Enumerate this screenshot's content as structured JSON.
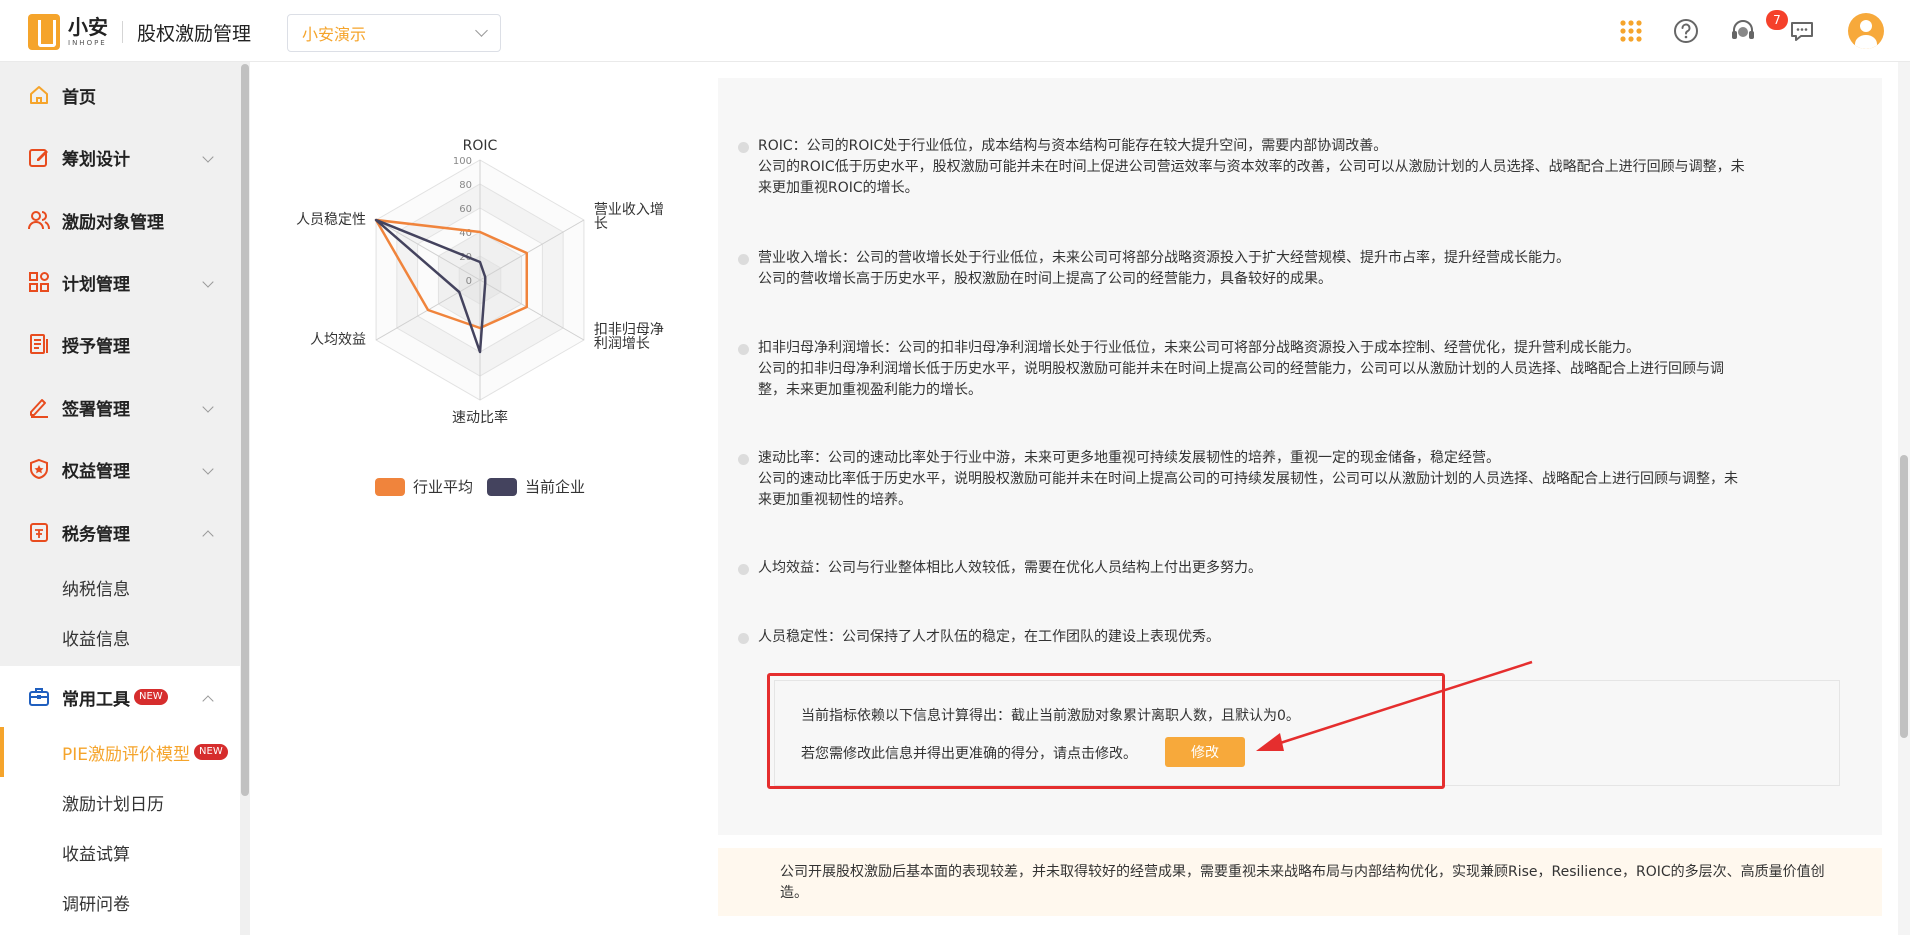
{
  "header": {
    "logo_cn": "小安",
    "logo_en": "INHOPE",
    "app_title": "股权激励管理",
    "company_selected": "小安演示",
    "icons": [
      "apps-grid-icon",
      "help-icon",
      "customer-service-icon",
      "message-icon",
      "user-avatar-icon"
    ],
    "message_badge": "7",
    "accent_color": "#f5a42b"
  },
  "sidebar": {
    "items": [
      {
        "label": "首页",
        "icon": "home-icon"
      },
      {
        "label": "筹划设计",
        "icon": "edit-icon"
      },
      {
        "label": "激励对象管理",
        "icon": "users-icon"
      },
      {
        "label": "计划管理",
        "icon": "apps-icon"
      },
      {
        "label": "授予管理",
        "icon": "document-icon"
      },
      {
        "label": "签署管理",
        "icon": "sign-icon"
      },
      {
        "label": "权益管理",
        "icon": "shield-icon"
      },
      {
        "label": "税务管理",
        "icon": "tax-icon"
      }
    ],
    "tax_sub": [
      "纳税信息",
      "收益信息"
    ],
    "tools": {
      "label": "常用工具",
      "new_tag": "NEW",
      "sub": [
        {
          "label": "PIE激励评价模型",
          "active": true,
          "new_tag": "NEW"
        },
        {
          "label": "激励计划日历"
        },
        {
          "label": "收益试算"
        },
        {
          "label": "调研问卷"
        }
      ]
    }
  },
  "chart_data": {
    "type": "radar",
    "indicators": [
      "ROIC",
      "营业收入增长",
      "扣非归母净利润增长",
      "速动比率",
      "人均效益",
      "人员稳定性"
    ],
    "max": 100,
    "ticks": [
      "100",
      "80",
      "60",
      "40",
      "20",
      "0"
    ],
    "series": [
      {
        "name": "行业平均",
        "color": "#f0843c",
        "values": [
          40,
          45,
          45,
          40,
          50,
          100
        ]
      },
      {
        "name": "当前企业",
        "color": "#44435e",
        "values": [
          15,
          5,
          5,
          60,
          20,
          100
        ]
      }
    ],
    "legend_position": "bottom"
  },
  "analysis": {
    "bullets": [
      {
        "lines": [
          "ROIC：公司的ROIC处于行业低位，成本结构与资本结构可能存在较大提升空间，需要内部协调改善。",
          "公司的ROIC低于历史水平，股权激励可能并未在时间上促进公司营运效率与资本效率的改善，公司可以从激励计划的人员选择、战略配合上进行回顾与调整，未",
          "来更加重视ROIC的增长。"
        ]
      },
      {
        "lines": [
          "营业收入增长：公司的营收增长处于行业低位，未来公司可将部分战略资源投入于扩大经营规模、提升市占率，提升经营成长能力。",
          "公司的营收增长高于历史水平，股权激励在时间上提高了公司的经营能力，具备较好的成果。"
        ]
      },
      {
        "lines": [
          "扣非归母净利润增长：公司的扣非归母净利润增长处于行业低位，未来公司可将部分战略资源投入于成本控制、经营优化，提升营利成长能力。",
          "公司的扣非归母净利润增长低于历史水平，说明股权激励可能并未在时间上提高公司的经营能力，公司可以从激励计划的人员选择、战略配合上进行回顾与调",
          "整，未来更加重视盈利能力的增长。"
        ]
      },
      {
        "lines": [
          "速动比率：公司的速动比率处于行业中游，未来可更多地重视可持续发展韧性的培养，重视一定的现金储备，稳定经营。",
          "公司的速动比率低于历史水平，说明股权激励可能并未在时间上提高公司的可持续发展韧性，公司可以从激励计划的人员选择、战略配合上进行回顾与调整，未",
          "来更加重视韧性的培养。"
        ]
      },
      {
        "lines": [
          "人均效益：公司与行业整体相比人效较低，需要在优化人员结构上付出更多努力。"
        ]
      },
      {
        "lines": [
          "人员稳定性：公司保持了人才队伍的稳定，在工作团队的建设上表现优秀。"
        ]
      }
    ],
    "info_line1": "当前指标依赖以下信息计算得出：截止当前激励对象累计离职人数，且默认为0。",
    "info_line2": "若您需修改此信息并得出更准确的得分，请点击修改。",
    "edit_button": "修改"
  },
  "summary": "公司开展股权激励后基本面的表现较差，并未取得较好的经营成果，需要重视未来战略布局与内部结构优化，实现兼顾Rise，Resilience，ROIC的多层次、高质量价值创造。"
}
